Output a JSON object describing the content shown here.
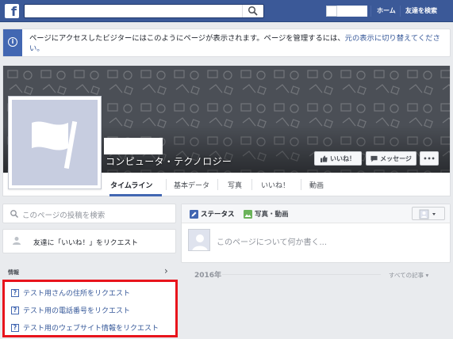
{
  "colors": {
    "brand": "#3b5998",
    "link": "#365899",
    "highlight_border": "#e8141c",
    "cover_bg": "#4b4f56",
    "page_bg": "#e9ebee"
  },
  "topbar": {
    "logo_glyph": "f",
    "logo_icon": "facebook-logo-icon",
    "search_icon": "magnifier-icon",
    "nav": {
      "home": "ホーム",
      "find_friends": "友達を検索"
    }
  },
  "notice": {
    "icon": "info-icon",
    "icon_glyph": "i",
    "message": "ページにアクセスしたビジターにはこのようにページが表示されます。ページを管理するには、",
    "link": "元の表示に切り替えてください。"
  },
  "profile": {
    "category": "コンピュータ・テクノロジー",
    "picture_icon": "flag-icon"
  },
  "cover_buttons": {
    "like": {
      "icon": "thumbs-up-icon",
      "label": "いいね！"
    },
    "message": {
      "icon": "speech-bubble-icon",
      "label": "メッセージ"
    },
    "more": {
      "label": "•••"
    }
  },
  "tabs": [
    {
      "label": "タイムライン",
      "active": true
    },
    {
      "label": "基本データ"
    },
    {
      "label": "写真"
    },
    {
      "label": "いいね！"
    },
    {
      "label": "動画"
    }
  ],
  "left": {
    "search_placeholder": "このページの投稿を検索",
    "request_like": "友達に「いいね！」をリクエスト",
    "info_title": "情報",
    "info_chevron": "›",
    "requests": [
      "テスト用さんの住所をリクエスト",
      "テスト用の電話番号をリクエスト",
      "テスト用のウェブサイト情報をリクエスト"
    ],
    "request_icon_glyph": "?"
  },
  "composer": {
    "tab_status": "ステータス",
    "tab_photo": "写真・動画",
    "prompt": "このページについて何か書く..."
  },
  "timeline": {
    "year": "2016年",
    "filter": "すべての記事 ▾"
  }
}
